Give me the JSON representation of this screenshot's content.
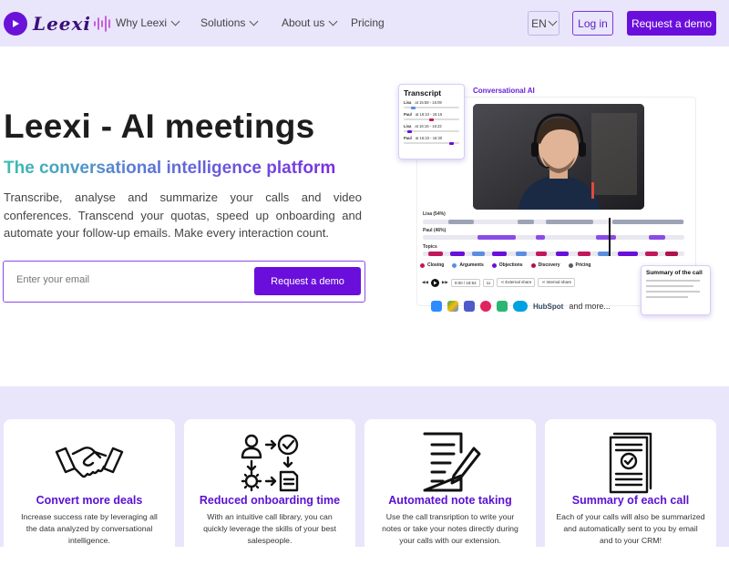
{
  "nav": {
    "brand": "Leexi",
    "links": [
      "Why Leexi",
      "Solutions",
      "About us",
      "Pricing"
    ],
    "language": "EN",
    "login_label": "Log in",
    "demo_label": "Request a demo"
  },
  "hero": {
    "title": "Leexi - AI meetings",
    "subtitle": "The conversational intelligence platform",
    "description": "Transcribe, analyse and summarize your calls and video conferences. Transcend your quotas, speed up onboarding and automate your follow-up emails. Make every interaction count.",
    "email_placeholder": "Enter your email",
    "cta_label": "Request a demo"
  },
  "mockup": {
    "conversational_label": "Conversational AI",
    "transcript": {
      "title": "Transcript",
      "rows": [
        {
          "speaker": "Lisa",
          "time": "at 15:58 - 16:09"
        },
        {
          "speaker": "Paul",
          "time": "at 16:10 - 16:15"
        },
        {
          "speaker": "Lisa",
          "time": "at 16:16 - 16:22"
        },
        {
          "speaker": "Paul",
          "time": "at 16:23 - 16:30"
        }
      ]
    },
    "timeline": {
      "lisa_label": "Lisa (54%)",
      "paul_label": "Paul (46%)",
      "topics_label": "Topics"
    },
    "legend": [
      "Closing",
      "Arguments",
      "Objections",
      "Discovery",
      "Pricing"
    ],
    "legend_colors": [
      "#c2185b",
      "#5b8ee0",
      "#6a0fdb",
      "#b0124a",
      "#555a66"
    ],
    "controls": {
      "time": "0:00 / 18:54",
      "speed": "1x",
      "external": "External share",
      "internal": "Internal share"
    },
    "integrations": {
      "hubspot": "HubSpot",
      "more": "and more..."
    },
    "summary_title": "Summary of the call"
  },
  "features": [
    {
      "icon": "handshake-icon",
      "title": "Convert more deals",
      "desc": "Increase success rate by leveraging all the data analyzed by conversational intelligence."
    },
    {
      "icon": "onboarding-flow-icon",
      "title": "Reduced onboarding time",
      "desc": "With an intuitive call library, you can quickly leverage the skills of your best salespeople."
    },
    {
      "icon": "note-writing-icon",
      "title": "Automated note taking",
      "desc": "Use the call transription to write your notes or take your notes directly during your calls with our extension."
    },
    {
      "icon": "summary-document-icon",
      "title": "Summary of each call",
      "desc": "Each of your calls will also be summarized and automatically sent to you by email and to your CRM!"
    }
  ],
  "colors": {
    "brand": "#6a0fdb",
    "nav_bg": "#e9e5fb",
    "feature_title": "#5a10d2"
  }
}
